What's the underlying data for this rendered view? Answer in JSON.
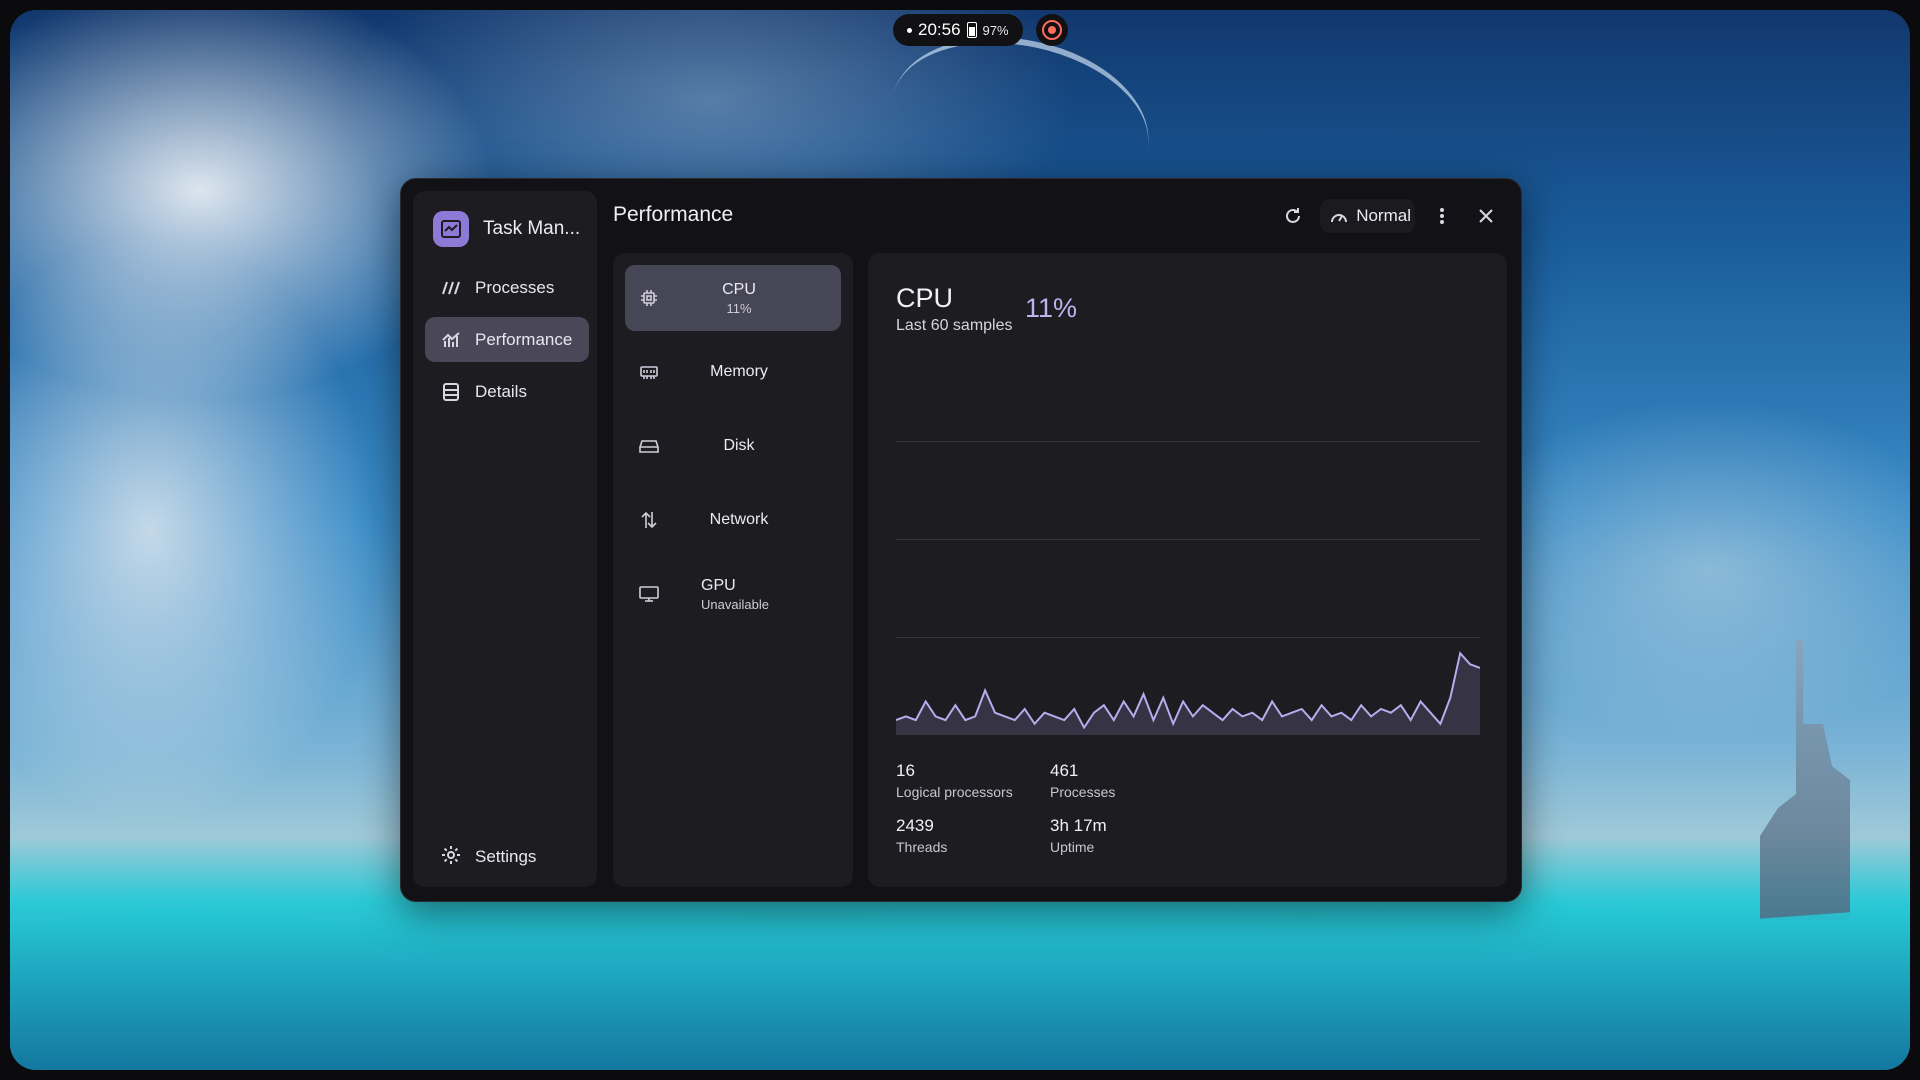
{
  "status_bar": {
    "time": "20:56",
    "battery": "97%"
  },
  "app": {
    "title": "Task Man..."
  },
  "nav": {
    "processes": "Processes",
    "performance": "Performance",
    "details": "Details",
    "settings": "Settings"
  },
  "header": {
    "title": "Performance",
    "mode_label": "Normal"
  },
  "resources": [
    {
      "name": "CPU",
      "sub": "11%",
      "icon": "cpu-icon"
    },
    {
      "name": "Memory",
      "sub": "",
      "icon": "memory-icon"
    },
    {
      "name": "Disk",
      "sub": "",
      "icon": "disk-icon"
    },
    {
      "name": "Network",
      "sub": "",
      "icon": "network-icon"
    },
    {
      "name": "GPU",
      "sub": "Unavailable",
      "icon": "monitor-icon"
    }
  ],
  "detail": {
    "title": "CPU",
    "percent": "11%",
    "subtitle": "Last 60 samples",
    "stats": [
      {
        "value": "16",
        "label": "Logical processors"
      },
      {
        "value": "461",
        "label": "Processes"
      },
      {
        "value": "2439",
        "label": "Threads"
      },
      {
        "value": "3h 17m",
        "label": "Uptime"
      }
    ]
  },
  "chart_data": {
    "type": "area",
    "ylim": [
      0,
      100
    ],
    "values": [
      4,
      5,
      4,
      9,
      5,
      4,
      8,
      4,
      5,
      12,
      6,
      5,
      4,
      7,
      3,
      6,
      5,
      4,
      7,
      2,
      6,
      8,
      4,
      9,
      5,
      11,
      4,
      10,
      3,
      9,
      5,
      8,
      6,
      4,
      7,
      5,
      6,
      4,
      9,
      5,
      6,
      7,
      4,
      8,
      5,
      6,
      4,
      8,
      5,
      7,
      6,
      8,
      4,
      9,
      6,
      3,
      10,
      22,
      19,
      18
    ],
    "color": "#b9acec"
  },
  "colors": {
    "accent": "#8d7ad6",
    "highlight": "#c0b2f0"
  }
}
